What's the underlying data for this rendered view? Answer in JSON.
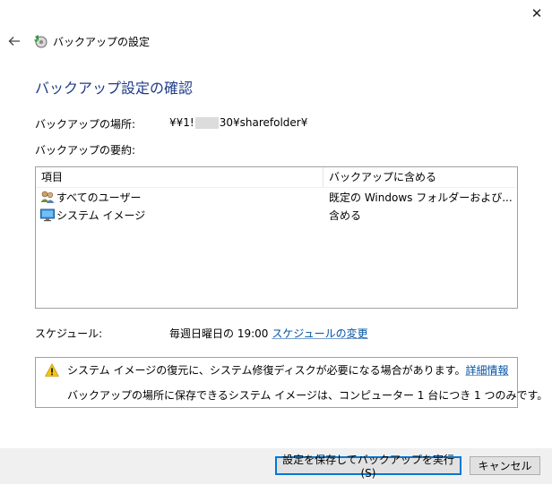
{
  "window": {
    "close_glyph": "✕"
  },
  "nav": {
    "title": "バックアップの設定",
    "back_icon": "arrow-left-icon",
    "app_icon": "backup-restore-icon"
  },
  "heading": "バックアップ設定の確認",
  "location": {
    "label": "バックアップの場所:",
    "value_prefix": "¥¥1!",
    "value_suffix": "30¥sharefolder¥"
  },
  "summary_label": "バックアップの要約:",
  "table": {
    "headers": [
      "項目",
      "バックアップに含める"
    ],
    "rows": [
      {
        "icon": "users-icon",
        "item": "すべてのユーザー",
        "included": "既定の Windows フォルダーおよび..."
      },
      {
        "icon": "monitor-icon",
        "item": "システム イメージ",
        "included": "含める"
      }
    ]
  },
  "schedule": {
    "label": "スケジュール:",
    "value": "毎週日曜日の 19:00",
    "link": "スケジュールの変更"
  },
  "warning": {
    "icon": "warning-icon",
    "line1": "システム イメージの復元に、システム修復ディスクが必要になる場合があります。",
    "line1_link": "詳細情報",
    "line2": "バックアップの場所に保存できるシステム イメージは、コンピューター 1 台につき 1 つのみです。"
  },
  "buttons": {
    "save_run": "設定を保存してバックアップを実行(S)",
    "cancel": "キャンセル"
  }
}
